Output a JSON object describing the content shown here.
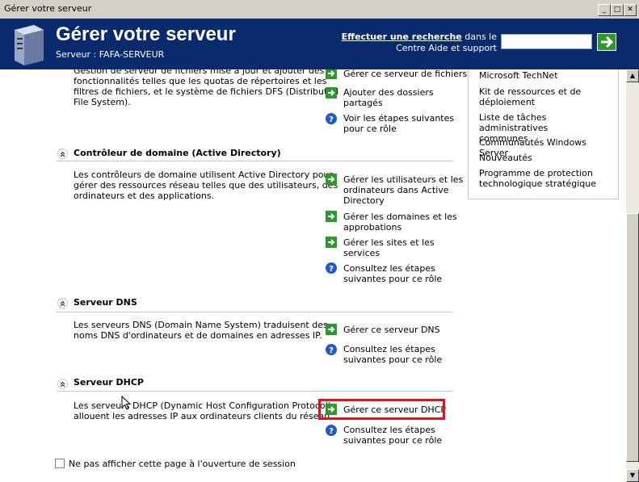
{
  "window": {
    "title": "Gérer votre serveur"
  },
  "header": {
    "title": "Gérer votre serveur",
    "server_label": "Serveur : FAFA-SERVEUR",
    "search_bold": "Effectuer une recherche",
    "search_rest1": " dans le",
    "search_line2": "Centre Aide et support",
    "search_value": ""
  },
  "sections": {
    "files": {
      "desc": [
        "Gestion de serveur de fichiers mise à jour et ajouter des",
        "fonctionnalités telles que les quotas de répertoires et les",
        "filtres de fichiers, et le système de fichiers DFS (Distributed",
        "File System)."
      ],
      "links": [
        {
          "lines": [
            "Gérer ce serveur de fichiers"
          ]
        },
        {
          "lines": [
            "Ajouter des dossiers",
            "partagés"
          ]
        },
        {
          "lines": [
            "Voir les étapes suivantes",
            "pour ce rôle"
          ]
        }
      ]
    },
    "dc": {
      "title": "Contrôleur de domaine (Active Directory)",
      "desc": [
        "Les contrôleurs de domaine utilisent Active Directory pour",
        "gérer des ressources réseau telles que des utilisateurs, des",
        "ordinateurs et des applications."
      ],
      "links": [
        {
          "lines": [
            "Gérer les utilisateurs et les",
            "ordinateurs dans Active",
            "Directory"
          ]
        },
        {
          "lines": [
            "Gérer les domaines et les",
            "approbations"
          ]
        },
        {
          "lines": [
            "Gérer les sites et les",
            "services"
          ]
        },
        {
          "lines": [
            "Consultez les étapes",
            "suivantes pour ce rôle"
          ]
        }
      ]
    },
    "dns": {
      "title": "Serveur DNS",
      "desc": [
        "Les serveurs DNS (Domain Name System) traduisent des",
        "noms DNS d'ordinateurs et de domaines en adresses IP."
      ],
      "links": [
        {
          "lines": [
            "Gérer ce serveur DNS"
          ]
        },
        {
          "lines": [
            "Consultez les étapes",
            "suivantes pour ce rôle"
          ]
        }
      ]
    },
    "dhcp": {
      "title": "Serveur DHCP",
      "desc": [
        "Les serveurs DHCP (Dynamic Host Configuration Protocol)",
        "allouent les adresses IP aux ordinateurs clients du réseau."
      ],
      "links": [
        {
          "lines": [
            "Gérer ce serveur DHCP"
          ]
        },
        {
          "lines": [
            "Consultez les étapes",
            "suivantes pour ce rôle"
          ]
        }
      ]
    }
  },
  "right_panel": [
    {
      "lines": [
        "Microsoft TechNet"
      ]
    },
    {
      "lines": [
        "Kit de ressources et de",
        "déploiement"
      ]
    },
    {
      "lines": [
        "Liste de tâches administratives",
        "communes"
      ]
    },
    {
      "lines": [
        "Communautés Windows Server"
      ]
    },
    {
      "lines": [
        "Nouveautés"
      ]
    },
    {
      "lines": [
        "Programme de protection",
        "technologique stratégique"
      ]
    }
  ],
  "footer": {
    "checkbox_label": "Ne pas afficher cette page à l'ouverture de session",
    "checked": false
  },
  "colors": {
    "banner": "#0a2a6e",
    "highlight": "#e0141e",
    "link_arrow": "#2b9a2b"
  }
}
